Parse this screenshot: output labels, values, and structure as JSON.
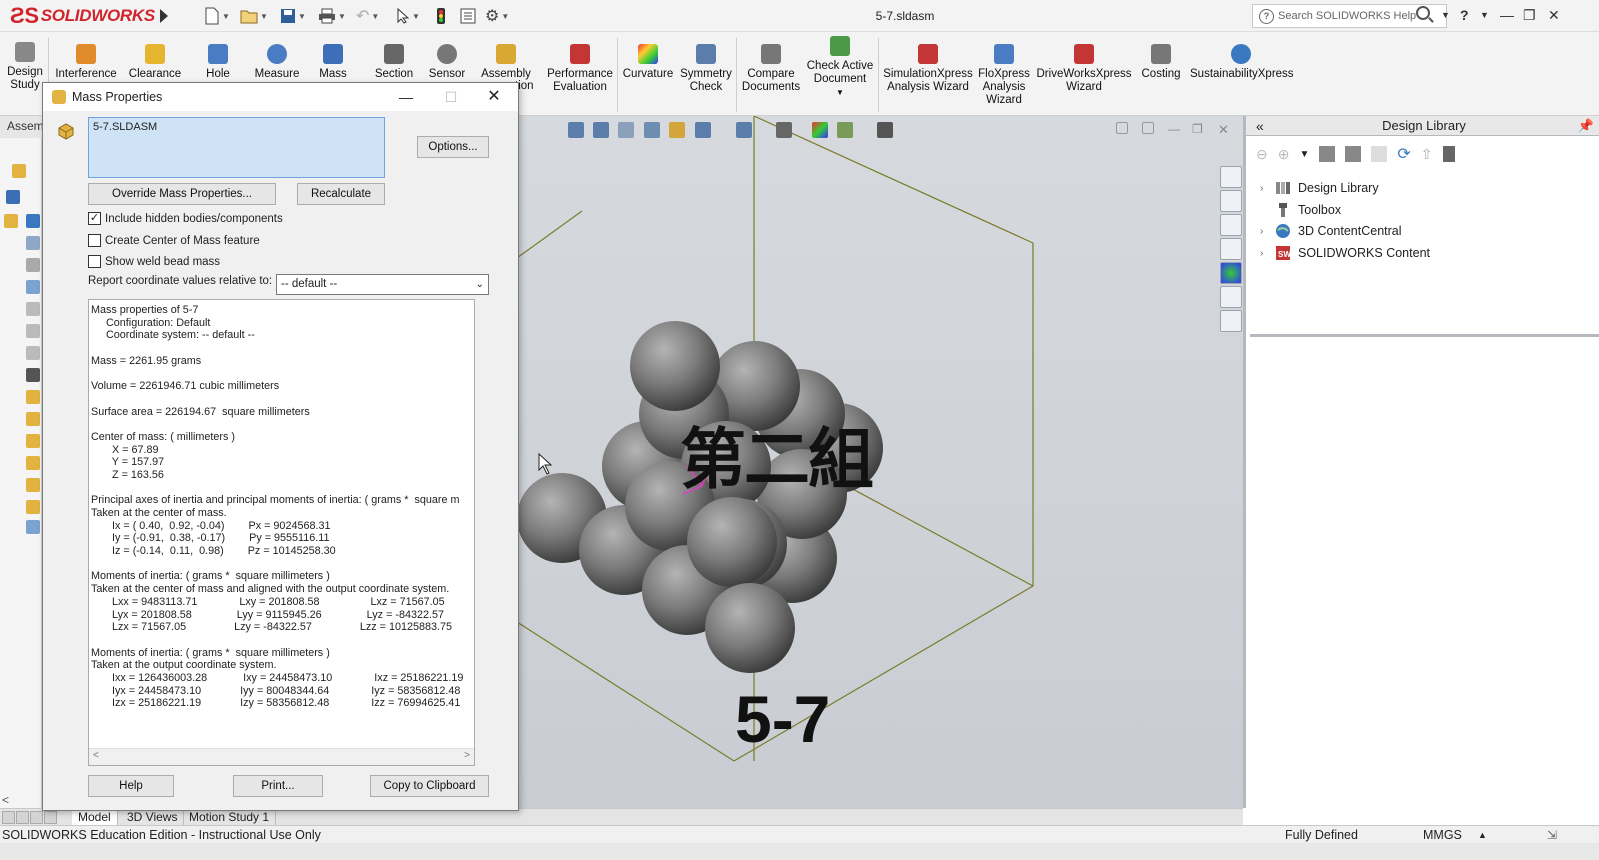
{
  "app": {
    "brand": "SOLIDWORKS",
    "doc_title": "5-7.sldasm"
  },
  "search": {
    "placeholder": "Search SOLIDWORKS Help"
  },
  "ribbon": {
    "items": [
      {
        "label": "Design\nStudy"
      },
      {
        "label": "Interference"
      },
      {
        "label": "Clearance"
      },
      {
        "label": "Hole"
      },
      {
        "label": "Measure"
      },
      {
        "label": "Mass"
      },
      {
        "label": "Section"
      },
      {
        "label": "Sensor"
      },
      {
        "label": "Assembly"
      },
      {
        "label": "Performance\nEvaluation"
      },
      {
        "label": "Curvature"
      },
      {
        "label": "Symmetry\nCheck"
      },
      {
        "label": "Compare\nDocuments"
      },
      {
        "label": "Check Active\nDocument"
      },
      {
        "label": "SimulationXpress\nAnalysis Wizard"
      },
      {
        "label": "FloXpress\nAnalysis\nWizard"
      },
      {
        "label": "DriveWorksXpress\nWizard"
      },
      {
        "label": "Costing"
      },
      {
        "label": "SustainabilityXpress"
      }
    ],
    "partial_label": "tion"
  },
  "left_panel": {
    "tab": "Assem"
  },
  "dialog": {
    "title": "Mass Properties",
    "selection": "5-7.SLDASM",
    "options_btn": "Options...",
    "override_btn": "Override Mass Properties...",
    "recalc_btn": "Recalculate",
    "chk_hidden": "Include hidden bodies/components",
    "chk_com": "Create Center of Mass feature",
    "chk_weld": "Show weld bead mass",
    "coord_label": "Report coordinate values relative to:",
    "coord_value": "-- default --",
    "results": [
      "Mass properties of 5-7",
      "     Configuration: Default",
      "     Coordinate system: -- default --",
      "",
      "Mass = 2261.95 grams",
      "",
      "Volume = 2261946.71 cubic millimeters",
      "",
      "Surface area = 226194.67  square millimeters",
      "",
      "Center of mass: ( millimeters )",
      "       X = 67.89",
      "       Y = 157.97",
      "       Z = 163.56",
      "",
      "Principal axes of inertia and principal moments of inertia: ( grams *  square m",
      "Taken at the center of mass.",
      "       Ix = ( 0.40,  0.92, -0.04)        Px = 9024568.31",
      "       Iy = (-0.91,  0.38, -0.17)        Py = 9555116.11",
      "       Iz = (-0.14,  0.11,  0.98)        Pz = 10145258.30",
      "",
      "Moments of inertia: ( grams *  square millimeters )",
      "Taken at the center of mass and aligned with the output coordinate system.",
      "       Lxx = 9483113.71              Lxy = 201808.58                 Lxz = 71567.05",
      "       Lyx = 201808.58               Lyy = 9115945.26               Lyz = -84322.57",
      "       Lzx = 71567.05                Lzy = -84322.57                Lzz = 10125883.75",
      "",
      "Moments of inertia: ( grams *  square millimeters )",
      "Taken at the output coordinate system.",
      "       Ixx = 126436003.28            Ixy = 24458473.10              Ixz = 25186221.19",
      "       Iyx = 24458473.10             Iyy = 80048344.64              Iyz = 58356812.48",
      "       Izx = 25186221.19             Izy = 58356812.48              Izz = 76994625.41"
    ],
    "help_btn": "Help",
    "print_btn": "Print...",
    "copy_btn": "Copy to Clipboard"
  },
  "viewport": {
    "overlay_text": "第二組",
    "model_label": "5-7"
  },
  "design_library": {
    "title": "Design Library",
    "items": [
      "Design Library",
      "Toolbox",
      "3D ContentCentral",
      "SOLIDWORKS Content"
    ]
  },
  "bottom_tabs": [
    "Model",
    "3D Views",
    "Motion Study 1"
  ],
  "status": {
    "left": "SOLIDWORKS Education Edition - Instructional Use Only",
    "state": "Fully Defined",
    "units": "MMGS"
  }
}
